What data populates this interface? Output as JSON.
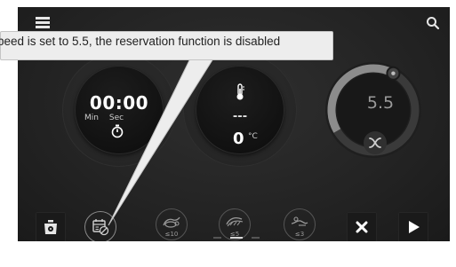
{
  "header": {
    "menu_icon": "menu-icon",
    "search_icon": "search-icon"
  },
  "tooltip": {
    "text": "peed is set to 5.5, the reservation function is disabled"
  },
  "timer": {
    "value": "00:00",
    "min_label": "Min",
    "sec_label": "Sec",
    "icon": "stopwatch-icon"
  },
  "temperature": {
    "icon": "thermometer-icon",
    "dash": "---",
    "value": "0",
    "unit": "°C"
  },
  "speed": {
    "value": "5.5",
    "level": 5.5,
    "icon": "fan-icon"
  },
  "bottom": {
    "weight_icon": "scale-icon",
    "reservation_icon": "reservation-disabled-icon",
    "modes": [
      {
        "label": "≤10",
        "icon": "mode-dough-icon"
      },
      {
        "label": "≤5",
        "icon": "mode-knead-icon"
      },
      {
        "label": "≤3",
        "icon": "mode-blend-icon"
      }
    ],
    "stop_icon": "close-icon",
    "play_icon": "play-icon"
  },
  "colors": {
    "background": "#232323",
    "dial": "#111111",
    "ring": "#8c8c8c",
    "tooltip_bg": "#ededed",
    "text": "#ffffff"
  }
}
